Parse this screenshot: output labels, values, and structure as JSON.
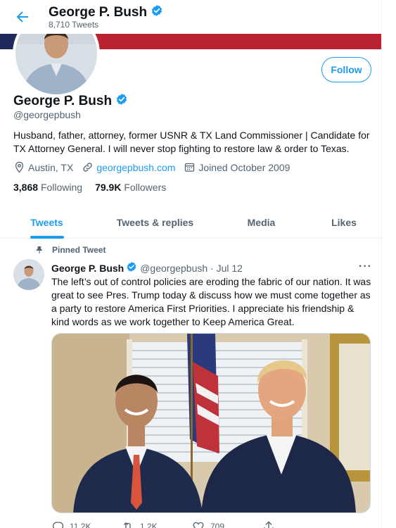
{
  "header": {
    "name": "George P. Bush",
    "tweet_count": "8,710 Tweets"
  },
  "profile": {
    "follow_label": "Follow",
    "name": "George P. Bush",
    "handle": "@georgepbush",
    "bio": "Husband, father, attorney, former USNR & TX Land Commissioner | Candidate for TX Attorney General. I will never stop fighting to restore law & order to Texas.",
    "location": "Austin, TX",
    "website": "georgepbush.com",
    "joined": "Joined October 2009",
    "following_count": "3,868",
    "following_label": "Following",
    "followers_count": "79.9K",
    "followers_label": "Followers"
  },
  "tabs": [
    {
      "label": "Tweets",
      "active": true
    },
    {
      "label": "Tweets & replies",
      "active": false
    },
    {
      "label": "Media",
      "active": false
    },
    {
      "label": "Likes",
      "active": false
    }
  ],
  "tweet": {
    "pinned_label": "Pinned Tweet",
    "author": "George P. Bush",
    "handle_date": "@georgepbush · Jul 12",
    "more": "···",
    "text": "The left’s out of control policies are eroding the fabric of our nation. It was great to see Pres. Trump today & discuss how we must come together as a party to restore America First Priorities. I appreciate his friendship & kind words as we work together to Keep America Great.",
    "actions": {
      "replies": "11.2K",
      "retweets": "1.2K",
      "likes": "709"
    }
  },
  "icons": {
    "back": "back-arrow-icon",
    "verified": "verified-badge-icon",
    "location": "location-pin-icon",
    "link": "link-icon",
    "calendar": "calendar-icon",
    "pin": "pin-icon",
    "reply": "reply-icon",
    "retweet": "retweet-icon",
    "like": "heart-icon",
    "share": "share-icon"
  },
  "colors": {
    "accent": "#1d9bf0",
    "text": "#0f1419",
    "muted": "#536471",
    "banner_red": "#b8232f",
    "banner_navy": "#1d2a5a"
  }
}
